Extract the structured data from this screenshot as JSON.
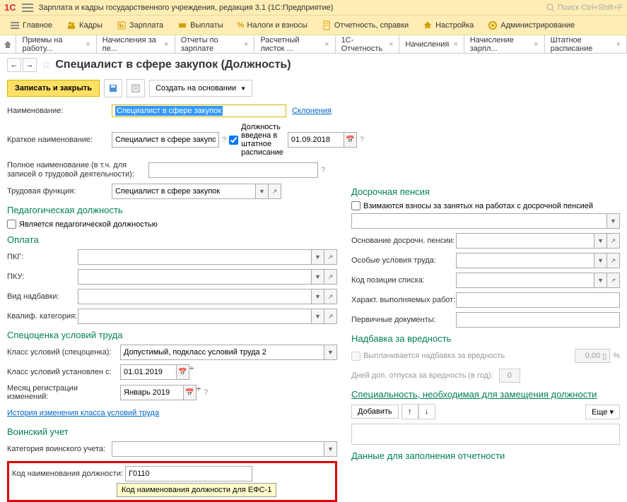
{
  "titlebar": {
    "logo": "1С",
    "title": "Зарплата и кадры государственного учреждения, редакция 3.1  (1С:Предприятие)",
    "search_placeholder": "Поиск Ctrl+Shift+F"
  },
  "menu": [
    {
      "label": "Главное"
    },
    {
      "label": "Кадры"
    },
    {
      "label": "Зарплата"
    },
    {
      "label": "Выплаты"
    },
    {
      "label": "Налоги и взносы"
    },
    {
      "label": "Отчетность, справки"
    },
    {
      "label": "Настройка"
    },
    {
      "label": "Администрирование"
    }
  ],
  "tabs": [
    "Приемы на работу...",
    "Начисления за пе...",
    "Отчеты по зарплате",
    "Расчетный листок ...",
    "1С-Отчетность",
    "Начисления",
    "Начисление зарпл...",
    "Штатное расписание"
  ],
  "page_title": "Специалист в сфере закупок (Должность)",
  "toolbar": {
    "save_close": "Записать и закрыть",
    "create_based": "Создать на основании"
  },
  "fields": {
    "name_label": "Наименование:",
    "name_value": "Специалист в сфере закупок",
    "declensions": "Склонения",
    "short_label": "Краткое наименование:",
    "short_value": "Специалист в сфере закупо",
    "in_schedule_label": "Должность введена в штатное расписание",
    "in_schedule_date": "01.09.2018",
    "full_label": "Полное наименование (в т.ч. для записей о трудовой деятельности):",
    "function_label": "Трудовая функция:",
    "function_value": "Специалист в сфере закупок"
  },
  "pedagogic": {
    "title": "Педагогическая должность",
    "checkbox": "Является педагогической должностью"
  },
  "payment": {
    "title": "Оплата",
    "pkg": "ПКГ:",
    "pku": "ПКУ:",
    "bonus_type": "Вид надбавки:",
    "category": "Квалиф. категория:"
  },
  "conditions": {
    "title": "Спецоценка условий труда",
    "class_label": "Класс условий (спецоценка):",
    "class_value": "Допустимый, подкласс условий труда 2",
    "set_from_label": "Класс условий установлен с:",
    "set_from_value": "01.01.2019",
    "month_label": "Месяц регистрации изменений:",
    "month_value": "Январь 2019",
    "history_link": "История изменения класса условий труда"
  },
  "military": {
    "title": "Воинский учет",
    "category_label": "Категория воинского учета:",
    "code_label": "Код наименования должности:",
    "code_value": "Г0110",
    "tooltip": "Код наименования должности для ЕФС-1"
  },
  "pension": {
    "title": "Досрочная пенсия",
    "checkbox": "Взимаются взносы за занятых на работах с досрочной пенсией",
    "basis": "Основание досрочн. пенсии:",
    "special": "Особые условия труда:",
    "list_code": "Код позиции списка:",
    "work_char": "Характ. выполняемых работ:",
    "primary_docs": "Первичные документы:"
  },
  "hazard": {
    "title": "Надбавка за вредность",
    "checkbox": "Выплачивается надбавка за вредность",
    "value": "0,00",
    "percent": "%",
    "days_label": "Дней доп. отпуска за вредность (в год):",
    "days_value": "0"
  },
  "specialty": {
    "title": "Специальность, необходимая для замещения должности",
    "add": "Добавить",
    "more": "Еще"
  },
  "reporting": {
    "title": "Данные для заполнения отчетности"
  }
}
